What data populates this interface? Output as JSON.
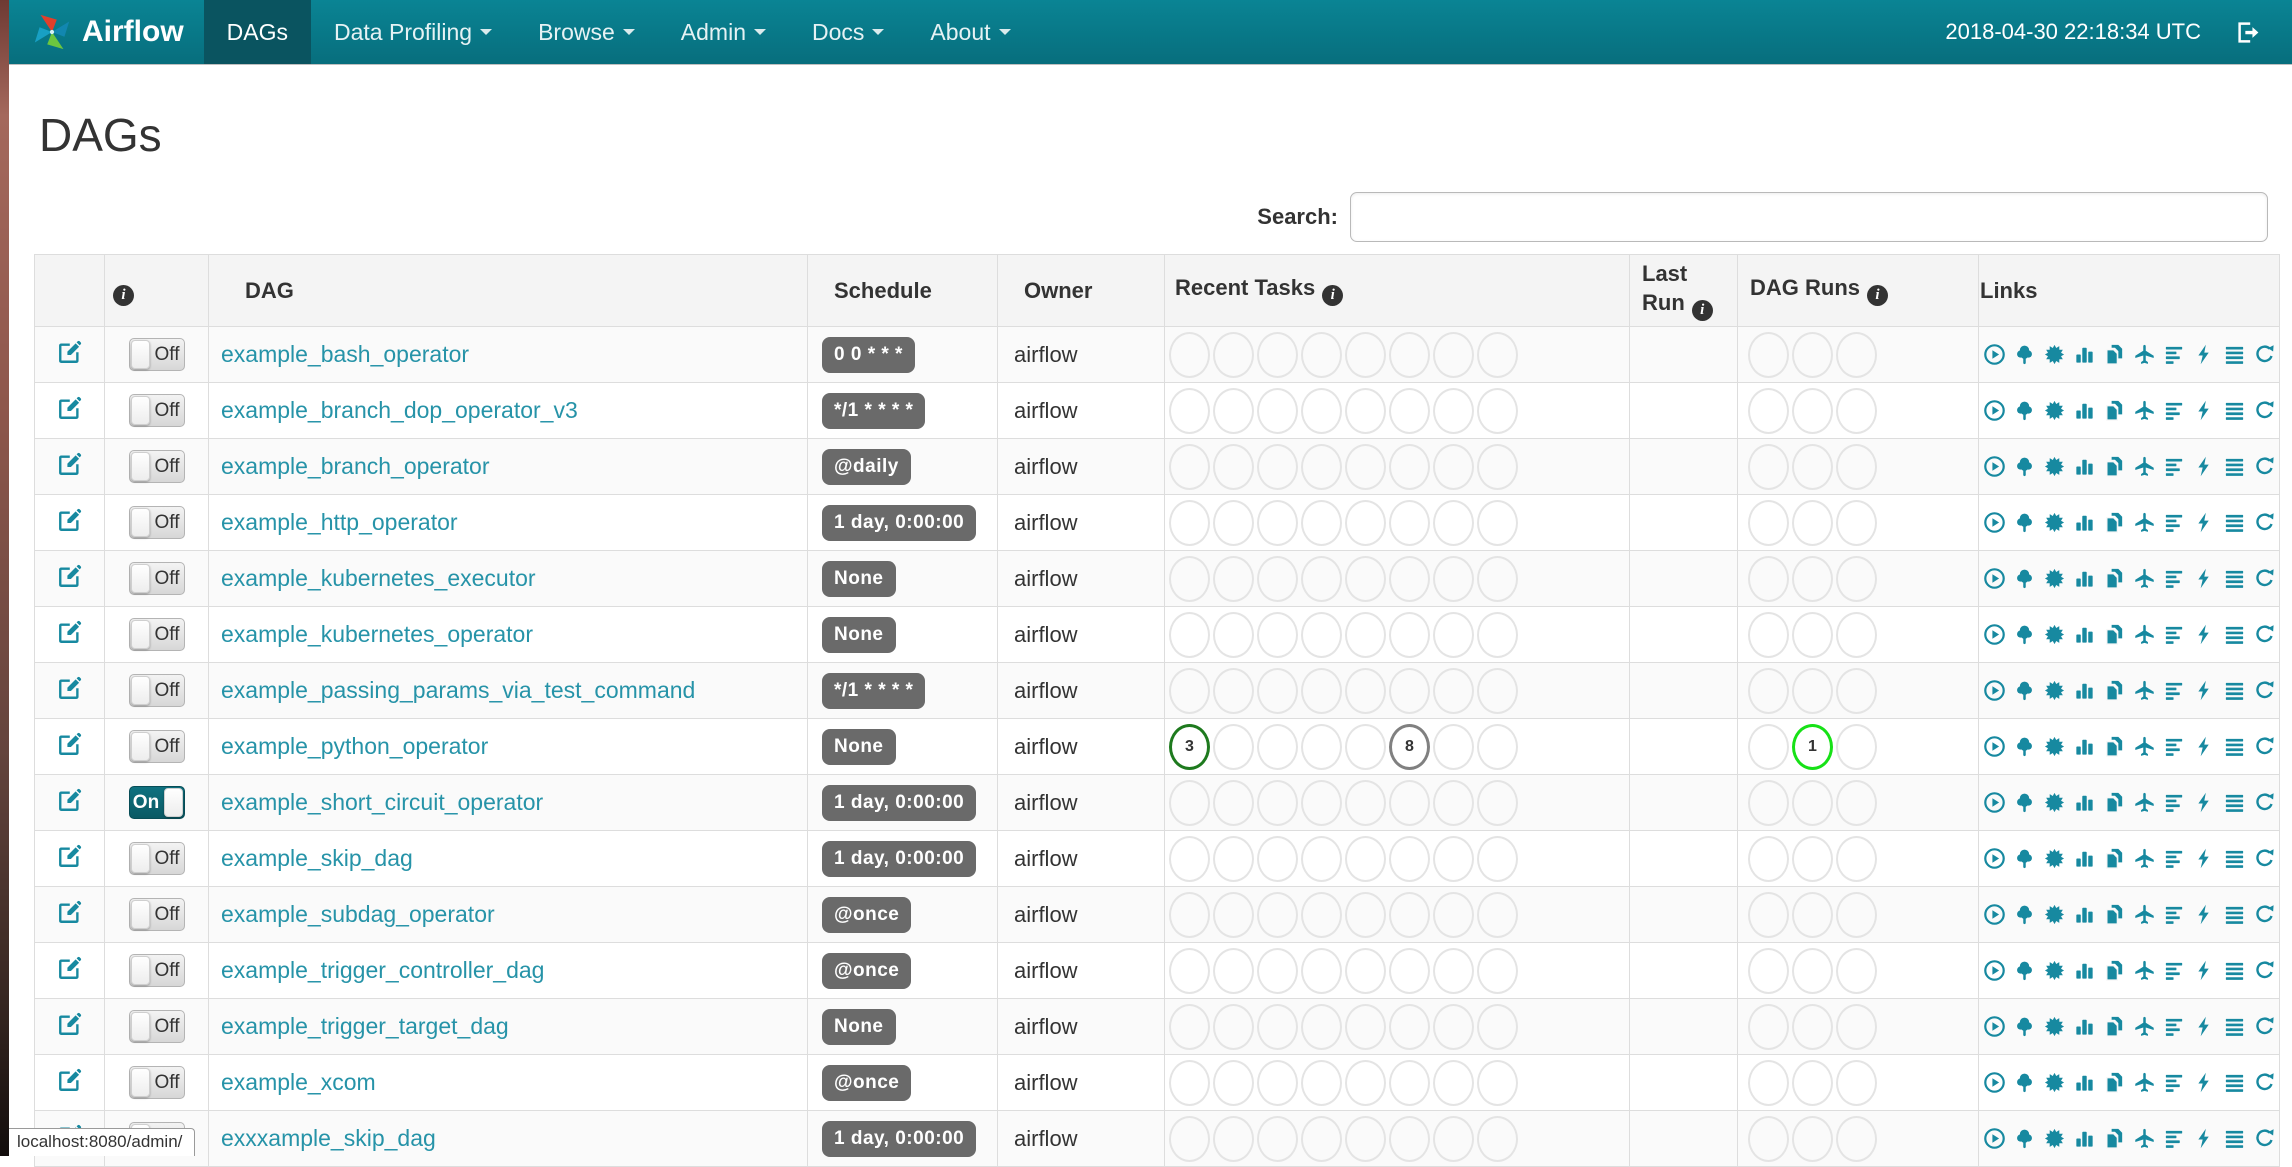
{
  "navbar": {
    "brand": "Airflow",
    "items": [
      {
        "label": "DAGs",
        "active": true,
        "caret": false
      },
      {
        "label": "Data Profiling",
        "active": false,
        "caret": true
      },
      {
        "label": "Browse",
        "active": false,
        "caret": true
      },
      {
        "label": "Admin",
        "active": false,
        "caret": true
      },
      {
        "label": "Docs",
        "active": false,
        "caret": true
      },
      {
        "label": "About",
        "active": false,
        "caret": true
      }
    ],
    "clock": "2018-04-30 22:18:34 UTC"
  },
  "page": {
    "title": "DAGs",
    "search_label": "Search:",
    "search_value": "",
    "status_bar": "localhost:8080/admin/"
  },
  "table": {
    "headers": {
      "dag": "DAG",
      "schedule": "Schedule",
      "owner": "Owner",
      "recent_tasks": "Recent Tasks",
      "last_run": "Last Run",
      "dag_runs": "DAG Runs",
      "links": "Links"
    },
    "recent_task_slots": 8,
    "dag_run_slots": 3,
    "links_icons": [
      "trigger-dag",
      "tree-view",
      "graph-view",
      "task-duration",
      "task-tries",
      "landing-times",
      "gantt",
      "code-view",
      "logs",
      "refresh"
    ],
    "state_colors": {
      "success": "#1e7a1e",
      "running": "#17e117",
      "queued": "#808080"
    },
    "rows": [
      {
        "dag": "example_bash_operator",
        "toggle": "Off",
        "schedule": "0 0 * * *",
        "owner": "airflow",
        "recent_tasks": [],
        "dag_runs": []
      },
      {
        "dag": "example_branch_dop_operator_v3",
        "toggle": "Off",
        "schedule": "*/1 * * * *",
        "owner": "airflow",
        "recent_tasks": [],
        "dag_runs": []
      },
      {
        "dag": "example_branch_operator",
        "toggle": "Off",
        "schedule": "@daily",
        "owner": "airflow",
        "recent_tasks": [],
        "dag_runs": []
      },
      {
        "dag": "example_http_operator",
        "toggle": "Off",
        "schedule": "1 day, 0:00:00",
        "owner": "airflow",
        "recent_tasks": [],
        "dag_runs": []
      },
      {
        "dag": "example_kubernetes_executor",
        "toggle": "Off",
        "schedule": "None",
        "owner": "airflow",
        "recent_tasks": [],
        "dag_runs": []
      },
      {
        "dag": "example_kubernetes_operator",
        "toggle": "Off",
        "schedule": "None",
        "owner": "airflow",
        "recent_tasks": [],
        "dag_runs": []
      },
      {
        "dag": "example_passing_params_via_test_command",
        "toggle": "Off",
        "schedule": "*/1 * * * *",
        "owner": "airflow",
        "recent_tasks": [],
        "dag_runs": []
      },
      {
        "dag": "example_python_operator",
        "toggle": "Off",
        "schedule": "None",
        "owner": "airflow",
        "recent_tasks": [
          {
            "slot": 0,
            "count": "3",
            "state": "success"
          },
          {
            "slot": 5,
            "count": "8",
            "state": "queued"
          }
        ],
        "dag_runs": [
          {
            "slot": 1,
            "count": "1",
            "state": "running"
          }
        ]
      },
      {
        "dag": "example_short_circuit_operator",
        "toggle": "On",
        "schedule": "1 day, 0:00:00",
        "owner": "airflow",
        "recent_tasks": [],
        "dag_runs": []
      },
      {
        "dag": "example_skip_dag",
        "toggle": "Off",
        "schedule": "1 day, 0:00:00",
        "owner": "airflow",
        "recent_tasks": [],
        "dag_runs": []
      },
      {
        "dag": "example_subdag_operator",
        "toggle": "Off",
        "schedule": "@once",
        "owner": "airflow",
        "recent_tasks": [],
        "dag_runs": []
      },
      {
        "dag": "example_trigger_controller_dag",
        "toggle": "Off",
        "schedule": "@once",
        "owner": "airflow",
        "recent_tasks": [],
        "dag_runs": []
      },
      {
        "dag": "example_trigger_target_dag",
        "toggle": "Off",
        "schedule": "None",
        "owner": "airflow",
        "recent_tasks": [],
        "dag_runs": []
      },
      {
        "dag": "example_xcom",
        "toggle": "Off",
        "schedule": "@once",
        "owner": "airflow",
        "recent_tasks": [],
        "dag_runs": []
      },
      {
        "dag": "exxxample_skip_dag",
        "toggle": "Off",
        "schedule": "1 day, 0:00:00",
        "owner": "airflow",
        "recent_tasks": [],
        "dag_runs": []
      }
    ]
  },
  "colors": {
    "navbar_top": "#0a8494",
    "navbar_bottom": "#076e7d",
    "navbar_active": "#0a5460",
    "accent": "#1789a0",
    "link": "#2693a8",
    "badge_bg": "#6a6a6a",
    "toggle_on": "#0f7280",
    "success": "#1e7a1e",
    "running": "#17e117",
    "queued": "#808080"
  }
}
